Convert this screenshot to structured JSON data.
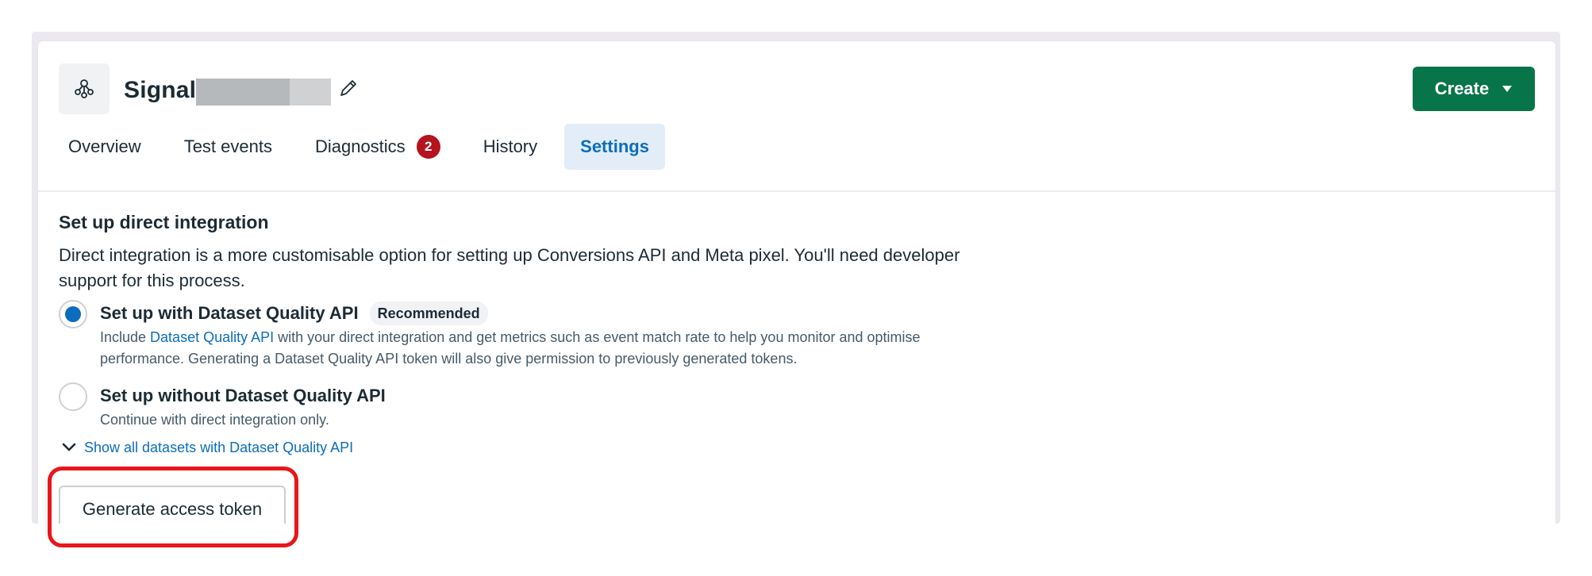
{
  "header": {
    "title": "Signal",
    "create_label": "Create",
    "tabs": [
      {
        "label": "Overview"
      },
      {
        "label": "Test events"
      },
      {
        "label": "Diagnostics",
        "badge": "2"
      },
      {
        "label": "History"
      },
      {
        "label": "Settings",
        "active": true
      }
    ]
  },
  "section": {
    "title": "Set up direct integration",
    "description": "Direct integration is a more customisable option for setting up Conversions API and Meta pixel. You'll need developer support for this process.",
    "option1": {
      "title": "Set up with Dataset Quality API",
      "pill": "Recommended",
      "desc_before": "Include ",
      "desc_link": "Dataset Quality API",
      "desc_after": " with your direct integration and get metrics such as event match rate to help you monitor and optimise performance. Generating a Dataset Quality API token will also give permission to previously generated tokens.",
      "selected": true
    },
    "option2": {
      "title": "Set up without Dataset Quality API",
      "desc": "Continue with direct integration only.",
      "selected": false
    },
    "show_all_label": "Show all datasets with Dataset Quality API",
    "generate_token_label": "Generate access token"
  },
  "colors": {
    "accent_blue": "#0b6dbd",
    "create_green": "#08744a",
    "badge_red": "#b3141e",
    "highlight_red": "#e8161a"
  }
}
